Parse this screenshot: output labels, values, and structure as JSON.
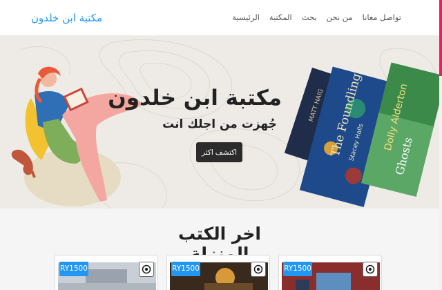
{
  "navbar": {
    "brand": "مكتبة ابن خلدون",
    "links": [
      "الرئيسية",
      "المكتبة",
      "بحث",
      "من نحن",
      "تواصل معانا"
    ]
  },
  "hero": {
    "title": "مكتبة ابن خلدون",
    "subtitle": "جُهزت من اجلك انت",
    "button": "اكتشف اكثر",
    "book_covers": [
      {
        "author": "Dolly Alderton",
        "title": "Ghosts"
      },
      {
        "title": "The Foundling",
        "author": "Stacey Halls"
      },
      {
        "author": "MATT HAIG"
      }
    ]
  },
  "latest": {
    "title": "اخر الكتب المنزلة",
    "cards": [
      {
        "price": "RY1500",
        "icon": "eye-icon"
      },
      {
        "price": "RY1500",
        "icon": "eye-icon"
      },
      {
        "price": "RY1500",
        "icon": "eye-icon"
      }
    ]
  },
  "colors": {
    "accent": "#2196f3",
    "dark_button": "#2b2b2b",
    "hero_bg": "#eeebe6",
    "scroll_thumb": "#e91e63"
  }
}
